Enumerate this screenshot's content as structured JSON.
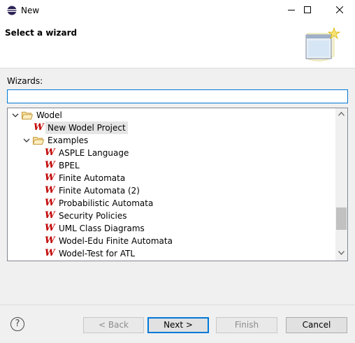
{
  "window": {
    "title": "New"
  },
  "header": {
    "title": "Select a wizard"
  },
  "filter": {
    "label": "Wizards:",
    "value": "",
    "placeholder": ""
  },
  "tree": {
    "root": {
      "label": "Wodel",
      "expanded": true
    },
    "new_project": {
      "label": "New Wodel Project",
      "selected": true
    },
    "examples": {
      "label": "Examples",
      "expanded": true
    },
    "items": [
      "ASPLE Language",
      "BPEL",
      "Finite Automata",
      "Finite Automata (2)",
      "Probabilistic Automata",
      "Security Policies",
      "UML Class Diagrams",
      "Wodel-Edu Finite Automata",
      "Wodel-Test for ATL"
    ],
    "item_icon_glyph": "W"
  },
  "buttons": {
    "back": "< Back",
    "next": "Next >",
    "finish": "Finish",
    "cancel": "Cancel",
    "help": "?"
  },
  "colors": {
    "accent": "#0078d7",
    "wodel_icon": "#c00000",
    "folder": "#dcb35c"
  }
}
